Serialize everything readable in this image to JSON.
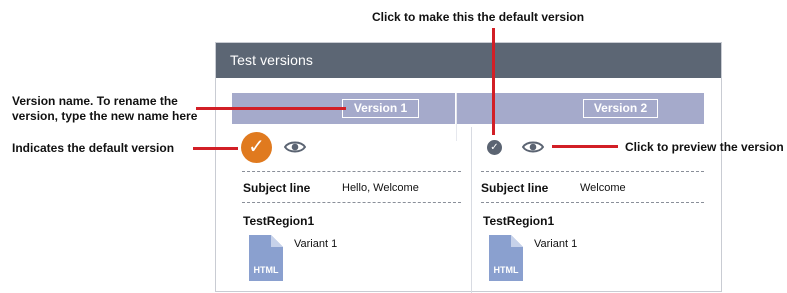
{
  "panel": {
    "title": "Test versions"
  },
  "versions": [
    {
      "name": "Version 1",
      "subject_label": "Subject line",
      "subject_value": "Hello, Welcome",
      "region": "TestRegion1",
      "variant": "Variant 1",
      "doc_type": "HTML"
    },
    {
      "name": "Version 2",
      "subject_label": "Subject line",
      "subject_value": "Welcome",
      "region": "TestRegion1",
      "variant": "Variant 1",
      "doc_type": "HTML"
    }
  ],
  "callouts": {
    "rename_line1": "Version name. To rename the",
    "rename_line2": "version, type the new name here",
    "default_indicator": "Indicates the default version",
    "make_default": "Click to make this the default version",
    "preview": "Click to preview the version"
  },
  "colors": {
    "header": "#5c6674",
    "band": "#a5aacb",
    "default_check": "#e07a1f",
    "callout_red": "#d21f26"
  },
  "icons": {
    "default": "check-circle-icon",
    "preview": "eye-icon",
    "document": "html-document-icon"
  }
}
